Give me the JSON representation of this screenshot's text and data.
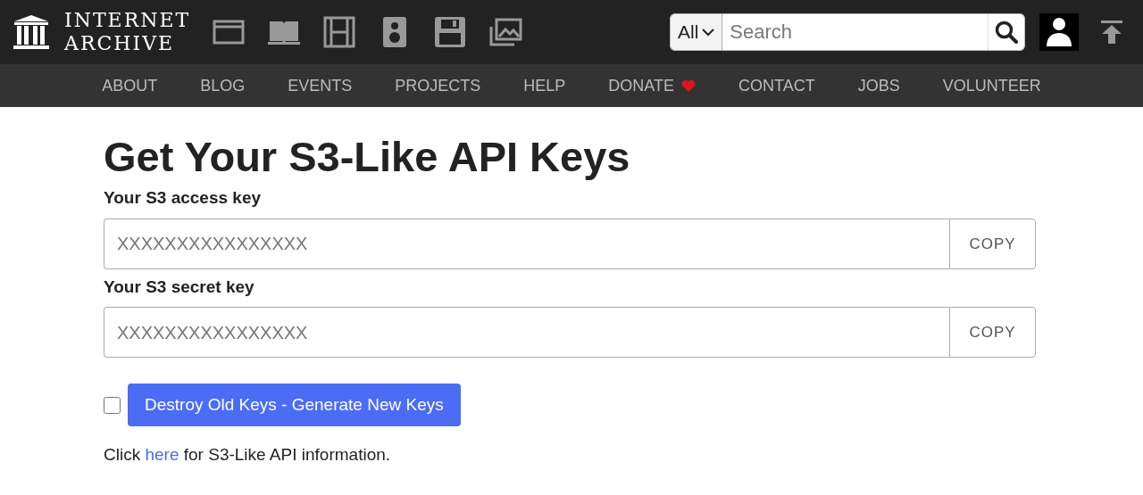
{
  "logo": {
    "line_1": "INTERNET",
    "line_2": "ARCHIVE"
  },
  "search": {
    "scope": "All",
    "placeholder": "Search"
  },
  "nav": [
    {
      "label": "ABOUT"
    },
    {
      "label": "BLOG"
    },
    {
      "label": "EVENTS"
    },
    {
      "label": "PROJECTS"
    },
    {
      "label": "HELP"
    },
    {
      "label": "DONATE",
      "kind": "donate"
    },
    {
      "label": "CONTACT"
    },
    {
      "label": "JOBS"
    },
    {
      "label": "VOLUNTEER"
    }
  ],
  "title": "Get Your S3-Like API Keys",
  "keys": [
    {
      "label": "Your S3 access key",
      "value": "XXXXXXXXXXXXXXXX",
      "button": "COPY"
    },
    {
      "label": "Your S3 secret key",
      "value": "XXXXXXXXXXXXXXXX",
      "button": "COPY"
    }
  ],
  "confirm": {
    "checked": false
  },
  "generate_button": "Destroy Old Keys - Generate New Keys",
  "info": {
    "before": "Click ",
    "link": "here",
    "after": " for S3-Like API information."
  }
}
